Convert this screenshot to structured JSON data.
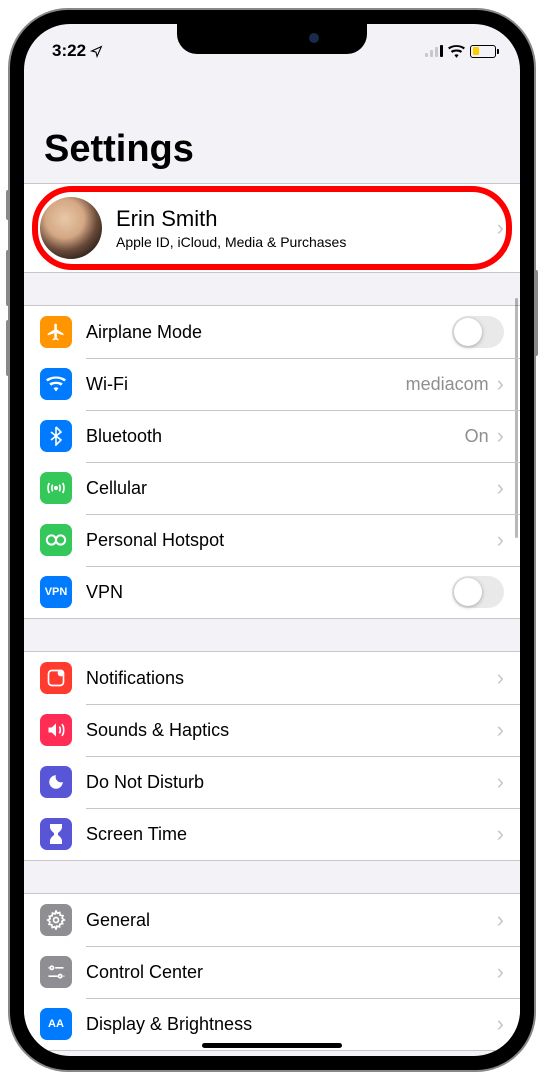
{
  "status": {
    "time": "3:22",
    "location_arrow": "➤"
  },
  "page_title": "Settings",
  "profile": {
    "name": "Erin Smith",
    "subtitle": "Apple ID, iCloud, Media & Purchases"
  },
  "groups": [
    {
      "rows": [
        {
          "id": "airplane",
          "label": "Airplane Mode",
          "icon_color": "#ff9500",
          "accessory": "toggle_off"
        },
        {
          "id": "wifi",
          "label": "Wi-Fi",
          "value": "mediacom",
          "icon_color": "#007aff",
          "accessory": "chevron"
        },
        {
          "id": "bluetooth",
          "label": "Bluetooth",
          "value": "On",
          "icon_color": "#007aff",
          "accessory": "chevron"
        },
        {
          "id": "cellular",
          "label": "Cellular",
          "icon_color": "#34c759",
          "accessory": "chevron"
        },
        {
          "id": "hotspot",
          "label": "Personal Hotspot",
          "icon_color": "#34c759",
          "accessory": "chevron"
        },
        {
          "id": "vpn",
          "label": "VPN",
          "icon_color": "#007aff",
          "accessory": "toggle_off",
          "icon_text": "VPN"
        }
      ]
    },
    {
      "rows": [
        {
          "id": "notifications",
          "label": "Notifications",
          "icon_color": "#ff3b30",
          "accessory": "chevron"
        },
        {
          "id": "sounds",
          "label": "Sounds & Haptics",
          "icon_color": "#ff2d55",
          "accessory": "chevron"
        },
        {
          "id": "dnd",
          "label": "Do Not Disturb",
          "icon_color": "#5856d6",
          "accessory": "chevron"
        },
        {
          "id": "screentime",
          "label": "Screen Time",
          "icon_color": "#5856d6",
          "accessory": "chevron"
        }
      ]
    },
    {
      "rows": [
        {
          "id": "general",
          "label": "General",
          "icon_color": "#8e8e93",
          "accessory": "chevron"
        },
        {
          "id": "controlcenter",
          "label": "Control Center",
          "icon_color": "#8e8e93",
          "accessory": "chevron"
        },
        {
          "id": "display",
          "label": "Display & Brightness",
          "icon_color": "#007aff",
          "accessory": "chevron",
          "icon_text": "AA"
        }
      ]
    }
  ]
}
